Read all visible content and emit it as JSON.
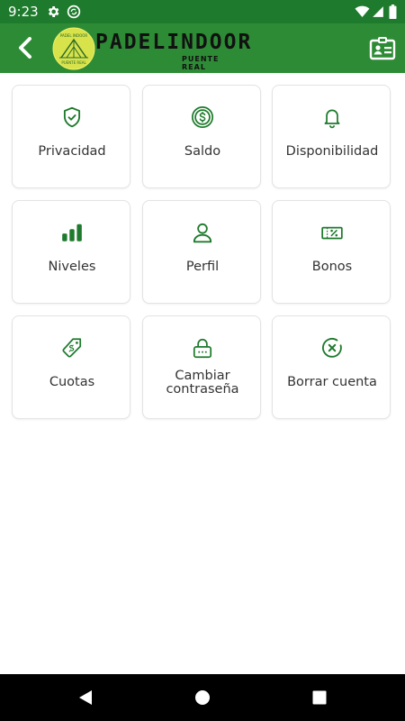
{
  "status_bar": {
    "time": "9:23",
    "icons": [
      "gear-icon",
      "sync-circle-icon",
      "wifi-icon",
      "signal-icon",
      "battery-icon"
    ]
  },
  "app_bar": {
    "back_icon": "back-arrow-icon",
    "logo": {
      "brand": "PADELINDOOR",
      "subtitle": "PUENTE REAL",
      "badge_top": "PADEL INDOOR",
      "badge_bottom": "PUENTE REAL"
    },
    "profile_icon": "id-card-icon",
    "background": "#2e8b35",
    "status_background": "#1e7a2c"
  },
  "menu": {
    "accent": "#1e7a2c",
    "tiles": [
      {
        "label": "Privacidad",
        "icon": "shield-check-icon"
      },
      {
        "label": "Saldo",
        "icon": "coin-dollar-icon"
      },
      {
        "label": "Disponibilidad",
        "icon": "bell-icon"
      },
      {
        "label": "Niveles",
        "icon": "signal-bars-icon"
      },
      {
        "label": "Perfil",
        "icon": "user-icon"
      },
      {
        "label": "Bonos",
        "icon": "ticket-percent-icon"
      },
      {
        "label": "Cuotas",
        "icon": "price-tag-icon"
      },
      {
        "label": "Cambiar contraseña",
        "icon": "lock-icon"
      },
      {
        "label": "Borrar cuenta",
        "icon": "delete-circle-icon"
      }
    ]
  },
  "nav_bar": {
    "buttons": [
      "back-triangle-icon",
      "home-circle-icon",
      "recents-square-icon"
    ]
  }
}
